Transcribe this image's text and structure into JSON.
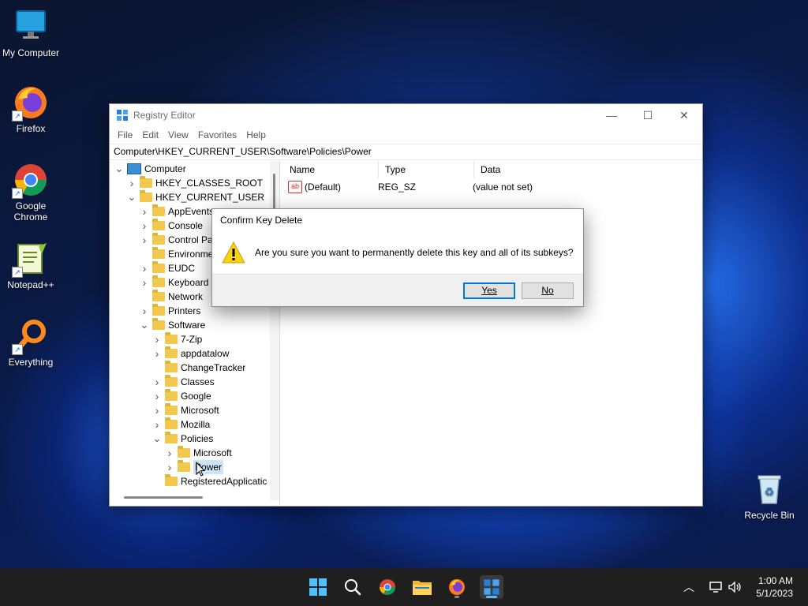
{
  "desktop": {
    "icons": [
      {
        "label": "My Computer"
      },
      {
        "label": "Firefox"
      },
      {
        "label": "Google Chrome"
      },
      {
        "label": "Notepad++"
      },
      {
        "label": "Everything"
      },
      {
        "label": "Recycle Bin"
      }
    ]
  },
  "window": {
    "title": "Registry Editor",
    "menu": [
      "File",
      "Edit",
      "View",
      "Favorites",
      "Help"
    ],
    "address": "Computer\\HKEY_CURRENT_USER\\Software\\Policies\\Power",
    "tree": [
      {
        "label": "Computer",
        "depth": 0,
        "state": "open"
      },
      {
        "label": "HKEY_CLASSES_ROOT",
        "depth": 1,
        "state": "closed"
      },
      {
        "label": "HKEY_CURRENT_USER",
        "depth": 1,
        "state": "open"
      },
      {
        "label": "AppEvents",
        "depth": 2,
        "state": "closed"
      },
      {
        "label": "Console",
        "depth": 2,
        "state": "closed"
      },
      {
        "label": "Control Pa",
        "depth": 2,
        "state": "closed"
      },
      {
        "label": "Environme",
        "depth": 2,
        "state": "none"
      },
      {
        "label": "EUDC",
        "depth": 2,
        "state": "closed"
      },
      {
        "label": "Keyboard L",
        "depth": 2,
        "state": "closed"
      },
      {
        "label": "Network",
        "depth": 2,
        "state": "none"
      },
      {
        "label": "Printers",
        "depth": 2,
        "state": "closed"
      },
      {
        "label": "Software",
        "depth": 2,
        "state": "open"
      },
      {
        "label": "7-Zip",
        "depth": 3,
        "state": "closed"
      },
      {
        "label": "appdatalow",
        "depth": 3,
        "state": "closed"
      },
      {
        "label": "ChangeTracker",
        "depth": 3,
        "state": "none"
      },
      {
        "label": "Classes",
        "depth": 3,
        "state": "closed"
      },
      {
        "label": "Google",
        "depth": 3,
        "state": "closed"
      },
      {
        "label": "Microsoft",
        "depth": 3,
        "state": "closed"
      },
      {
        "label": "Mozilla",
        "depth": 3,
        "state": "closed"
      },
      {
        "label": "Policies",
        "depth": 3,
        "state": "open"
      },
      {
        "label": "Microsoft",
        "depth": 4,
        "state": "closed"
      },
      {
        "label": "Power",
        "depth": 4,
        "state": "closed",
        "selected": true
      },
      {
        "label": "RegisteredApplicatic",
        "depth": 3,
        "state": "none"
      }
    ],
    "columns": {
      "name": "Name",
      "type": "Type",
      "data": "Data"
    },
    "values": [
      {
        "name": "(Default)",
        "type": "REG_SZ",
        "data": "(value not set)"
      }
    ]
  },
  "dialog": {
    "title": "Confirm Key Delete",
    "message": "Are you sure you want to permanently delete this key and all of its subkeys?",
    "yes_label": "Yes",
    "no_label": "No"
  },
  "taskbar": {
    "time": "1:00 AM",
    "date": "5/1/2023"
  }
}
